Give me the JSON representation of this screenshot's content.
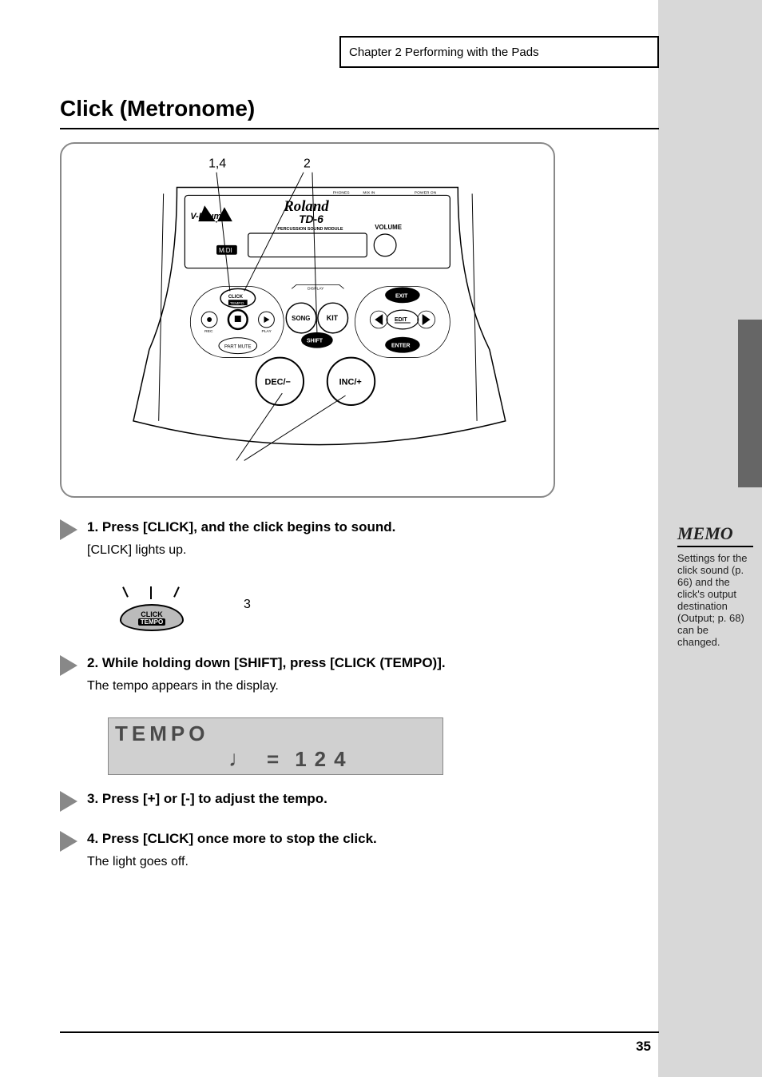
{
  "chapter": "Chapter 2 Performing with the Pads",
  "sectionTitle": "Click (Metronome)",
  "panel": {
    "brand": "Roland",
    "model": "TD-6",
    "subtitle": "PERCUSSION SOUND MODULE",
    "logoLabel": "V-Drums",
    "midiLabel": "MIDI",
    "volumeLabel": "VOLUME",
    "topLabels": {
      "phones": "PHONES",
      "mixin": "MIX IN",
      "power": "POWER ON"
    },
    "displayCap": "DISPLAY",
    "buttons": {
      "click": "CLICK",
      "tempo": "TEMPO",
      "rec": "REC",
      "stop": "STOP",
      "play": "PLAY",
      "partMute": "PART MUTE",
      "song": "SONG",
      "kit": "KIT",
      "shift": "SHIFT",
      "exit": "EXIT",
      "edit": "EDIT",
      "enter": "ENTER",
      "dec": "DEC/−",
      "inc": "INC/+"
    },
    "callouts": {
      "step1": "1,4",
      "step2": "2",
      "step3": "3"
    }
  },
  "steps": {
    "s1": {
      "line": "Press [CLICK], and the click begins to sound.",
      "sub": "[CLICK] lights up."
    },
    "s2": {
      "line": "While holding down [SHIFT], press [CLICK (TEMPO)].",
      "sub": "The tempo appears in the display."
    },
    "s3": {
      "line": "Press [+] or [-] to adjust the tempo."
    },
    "s4": {
      "line": "Press [CLICK] once more to stop the click.",
      "sub": "The light goes off."
    }
  },
  "lcd": {
    "top": "TEMPO",
    "note": "♩",
    "equals": "=",
    "value": "124"
  },
  "clickIcon": {
    "line1": "CLICK",
    "line2": "TEMPO"
  },
  "memo": {
    "header": "MEMO",
    "body": "Settings for the click sound (p. 66) and the click's output destination (Output; p. 68) can be changed."
  },
  "pageNumber": "35"
}
